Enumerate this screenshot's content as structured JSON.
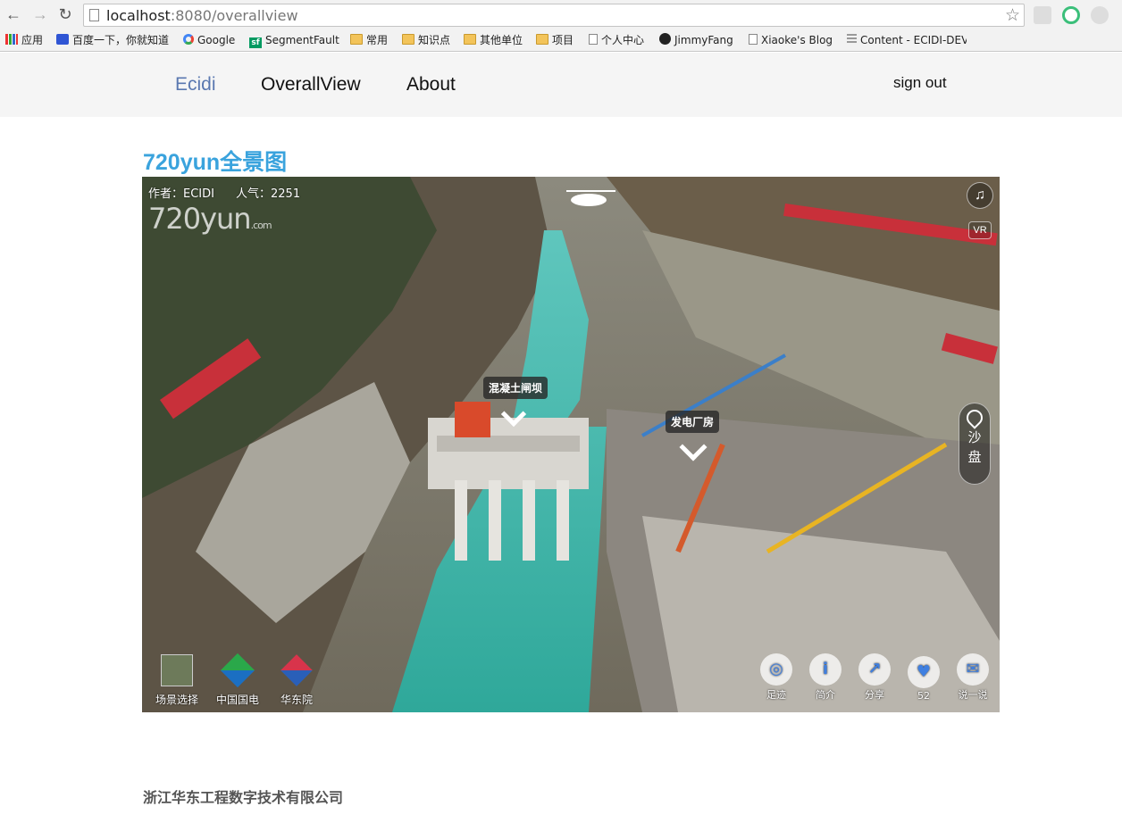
{
  "browser": {
    "url_host": "localhost",
    "url_path": ":8080/overallview",
    "bookmarks": [
      "应用",
      "百度一下，你就知道",
      "Google",
      "SegmentFault",
      "常用",
      "知识点",
      "其他单位",
      "项目",
      "个人中心",
      "JimmyFang",
      "Xiaoke's Blog",
      "Content - ECIDI-DEV"
    ]
  },
  "navbar": {
    "brand": "Ecidi",
    "links": [
      "OverallView",
      "About"
    ],
    "signout": "sign out"
  },
  "main": {
    "title": "720yun全景图",
    "viewer": {
      "author": "作者：ECIDI",
      "popularity": "人气：2251",
      "logo": "720",
      "logo_suffix": "yun",
      "logo_domain": ".com",
      "hotspots": [
        "混凝土闸坝",
        "发电厂房"
      ],
      "sandpan": [
        "沙",
        "盘"
      ],
      "bottom_left": [
        "场景选择",
        "中国国电",
        "华东院"
      ],
      "tools": [
        {
          "label": "足迹",
          "icon": "location-icon"
        },
        {
          "label": "简介",
          "icon": "info-icon"
        },
        {
          "label": "分享",
          "icon": "share-icon"
        },
        {
          "label": "52",
          "icon": "like-icon"
        },
        {
          "label": "说一说",
          "icon": "comment-icon"
        }
      ]
    }
  },
  "footer": {
    "company": "浙江华东工程数字技术有限公司"
  }
}
